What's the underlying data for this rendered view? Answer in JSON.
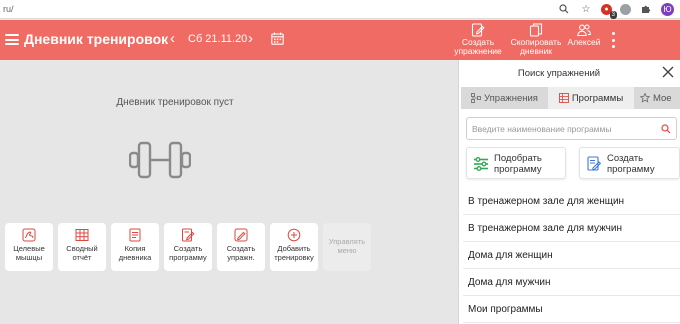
{
  "browser": {
    "url_fragment": "ru/",
    "extension_badge": "3",
    "profile_letter": "Ю",
    "search_icon": "magnifier-icon",
    "star_icon": "star-icon",
    "extensions_icon": "puzzle-icon"
  },
  "header": {
    "title": "Дневник тренировок",
    "date": "Сб 21.11.20",
    "prev_icon": "chevron-left-icon",
    "next_icon": "chevron-right-icon",
    "calendar_icon": "calendar-icon",
    "create_exercise": "Создать\nупражнение",
    "copy_diary": "Скопировать\nдневник",
    "user_name": "Алексей",
    "background_color": "#f06b63"
  },
  "main": {
    "empty_message": "Дневник тренировок пуст",
    "placeholder_icon": "dumbbell-icon",
    "tiles": [
      {
        "label": "Целевые\nмышцы",
        "icon": "muscle-icon"
      },
      {
        "label": "Сводный\nотчёт",
        "icon": "table-icon"
      },
      {
        "label": "Копия\nдневника",
        "icon": "copy-icon"
      },
      {
        "label": "Создать\nпрограмму",
        "icon": "edit-doc-icon"
      },
      {
        "label": "Создать\nупражн.",
        "icon": "edit-icon"
      },
      {
        "label": "Добавить\nтренировку",
        "icon": "plus-circle-icon"
      },
      {
        "label": "Управлять\nменю",
        "icon": ""
      }
    ]
  },
  "panel": {
    "title": "Поиск упражнений",
    "tabs": [
      {
        "label": "Упражнения",
        "icon": "nodes-icon"
      },
      {
        "label": "Программы",
        "icon": "grid-icon",
        "active": true
      },
      {
        "label": "Мое",
        "icon": "star-icon"
      }
    ],
    "search_placeholder": "Введите наименование программы",
    "pick_program": "Подобрать\nпрограмму",
    "create_program": "Создать\nпрограмму",
    "programs": [
      "В тренажерном зале для женщин",
      "В тренажерном зале для мужчин",
      "Дома для женщин",
      "Дома для мужчин",
      "Мои программы"
    ]
  }
}
